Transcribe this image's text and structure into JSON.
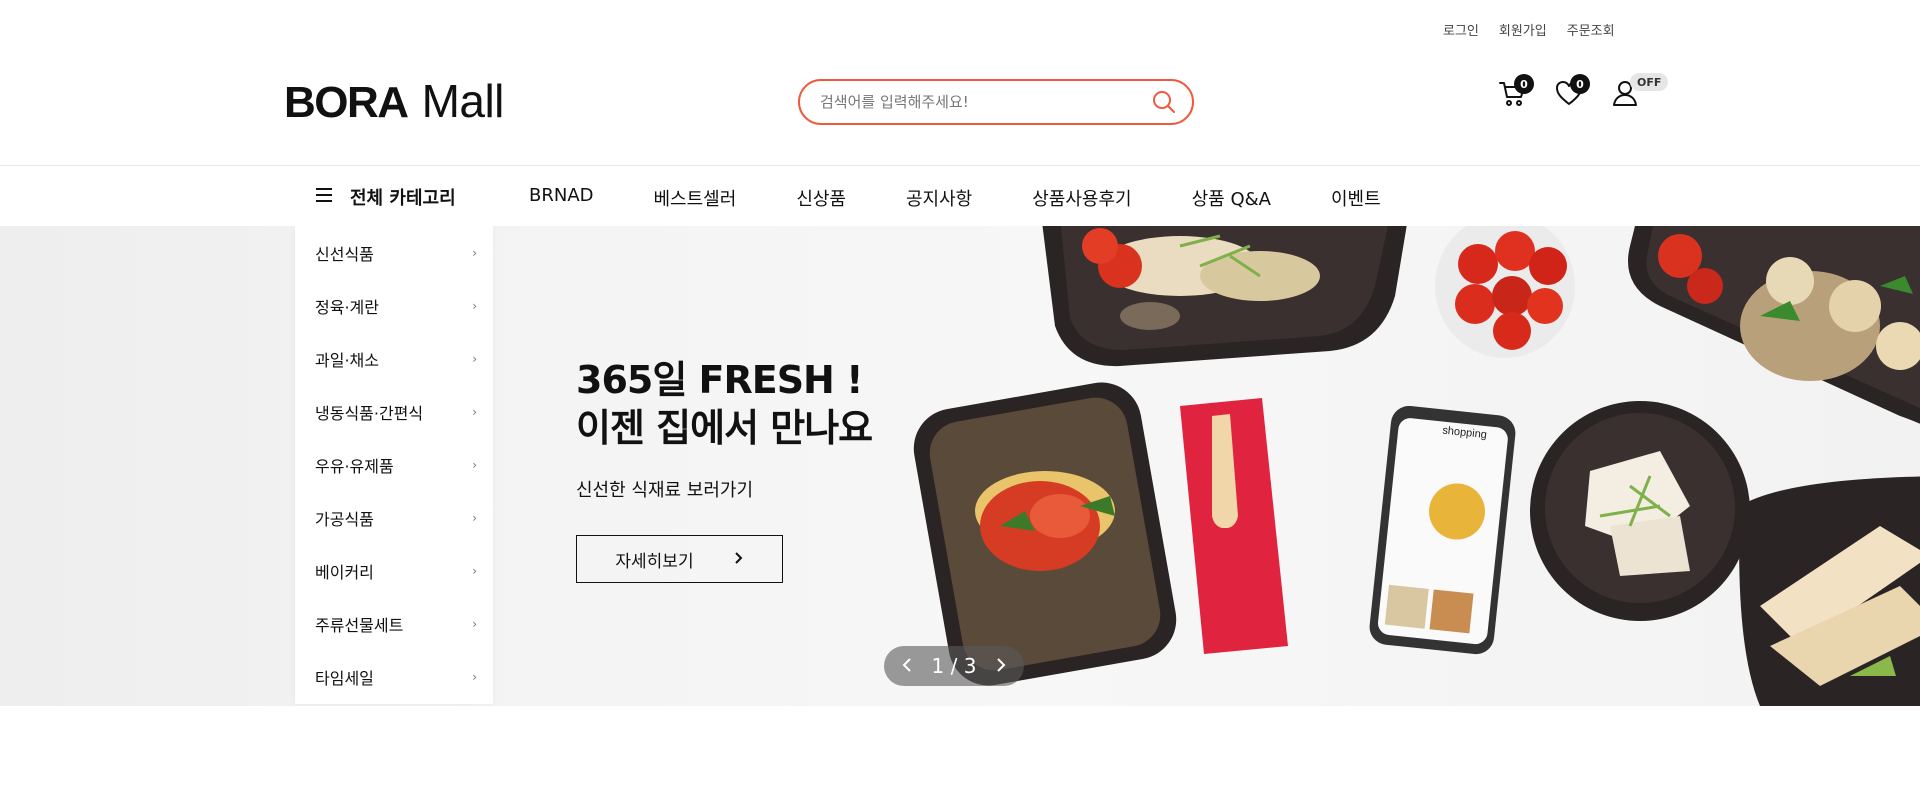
{
  "util_links": {
    "login": "로그인",
    "signup": "회원가입",
    "order_lookup": "주문조회"
  },
  "logo": {
    "bold": "BORA",
    "light": "Mall"
  },
  "search": {
    "placeholder": "검색어를 입력해주세요!"
  },
  "header_icons": {
    "cart_count": "0",
    "wishlist_count": "0",
    "account_badge": "OFF"
  },
  "nav": {
    "all_categories": "전체 카테고리",
    "items": [
      "BRNAD",
      "베스트셀러",
      "신상품",
      "공지사항",
      "상품사용후기",
      "상품 Q&A",
      "이벤트"
    ]
  },
  "sidebar": {
    "categories": [
      "신선식품",
      "정육·계란",
      "과일·채소",
      "냉동식품·간편식",
      "우유·유제품",
      "가공식품",
      "베이커리",
      "주류선물세트",
      "타임세일"
    ]
  },
  "banner": {
    "title_line1": "365일 FRESH !",
    "title_line2": "이젠 집에서 만나요",
    "subtitle": "신선한 식재료 보러가기",
    "cta": "자세히보기",
    "pager": "1 / 3",
    "phone_brand": "shopping"
  },
  "colors": {
    "accent": "#ef5a3c",
    "dark": "#111111"
  }
}
